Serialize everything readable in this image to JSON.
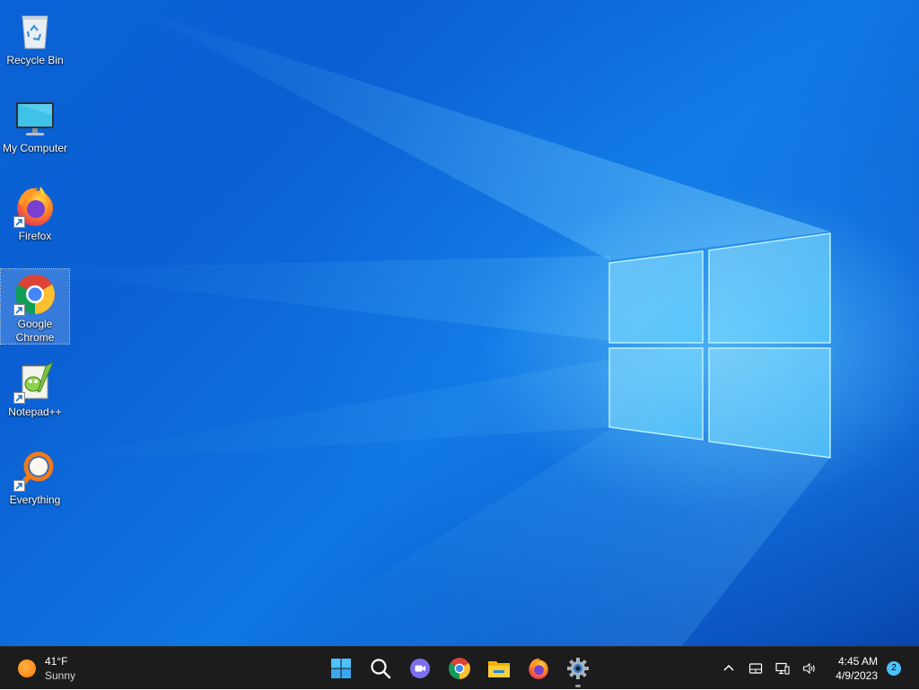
{
  "desktop": {
    "icons": [
      {
        "label": "Recycle Bin",
        "icon": "recycle-bin-icon"
      },
      {
        "label": "My Computer",
        "icon": "monitor-icon"
      },
      {
        "label": "Firefox",
        "icon": "firefox-icon"
      },
      {
        "label": "Google Chrome",
        "icon": "chrome-icon",
        "selected": true
      },
      {
        "label": "Notepad++",
        "icon": "notepadpp-icon"
      },
      {
        "label": "Everything",
        "icon": "everything-search-icon"
      }
    ]
  },
  "taskbar": {
    "weather": {
      "temp": "41°F",
      "condition": "Sunny",
      "icon": "sun-icon"
    },
    "apps": [
      {
        "name": "Start",
        "icon": "windows-start-icon"
      },
      {
        "name": "Search",
        "icon": "search-icon"
      },
      {
        "name": "Chat",
        "icon": "chat-icon"
      },
      {
        "name": "Google Chrome",
        "icon": "chrome-icon"
      },
      {
        "name": "File Explorer",
        "icon": "folder-icon"
      },
      {
        "name": "Firefox",
        "icon": "firefox-icon"
      },
      {
        "name": "Settings",
        "icon": "gear-icon",
        "running": true
      }
    ],
    "tray": {
      "icons": [
        "chevron-up-icon",
        "tablet-icon",
        "network-icon",
        "speaker-icon"
      ],
      "time": "4:45 AM",
      "date": "4/9/2023",
      "notifications": "2"
    }
  },
  "colors": {
    "accent": "#0a63d6",
    "taskbar": "#1c1c1c",
    "notification_badge": "#4cc2ff"
  }
}
